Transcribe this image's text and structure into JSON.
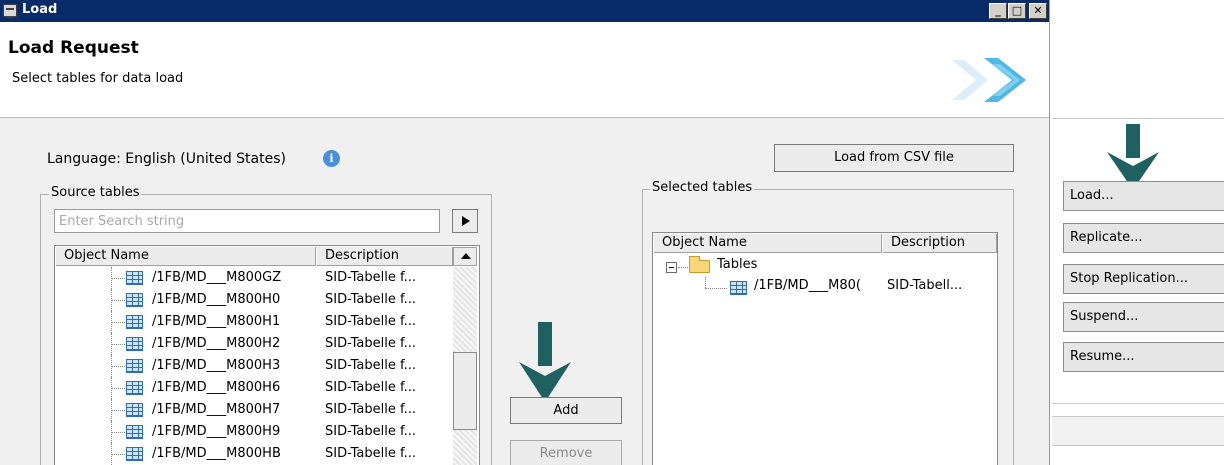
{
  "window": {
    "title": "Load",
    "controls": [
      "minimize",
      "maximize",
      "close"
    ]
  },
  "header": {
    "title": "Load Request",
    "subtitle": "Select tables for data load"
  },
  "language": {
    "label": "Language: English (United States)",
    "info_icon": "info-icon"
  },
  "buttons": {
    "load_csv": "Load from CSV file",
    "add": "Add",
    "remove": "Remove"
  },
  "source_tables": {
    "legend": "Source tables",
    "search_placeholder": "Enter Search string",
    "columns": [
      "Object Name",
      "Description"
    ],
    "rows": [
      {
        "name": "/1FB/MD___M800GZ",
        "description": "SID-Tabelle f..."
      },
      {
        "name": "/1FB/MD___M800H0",
        "description": "SID-Tabelle f..."
      },
      {
        "name": "/1FB/MD___M800H1",
        "description": "SID-Tabelle f..."
      },
      {
        "name": "/1FB/MD___M800H2",
        "description": "SID-Tabelle f..."
      },
      {
        "name": "/1FB/MD___M800H3",
        "description": "SID-Tabelle f..."
      },
      {
        "name": "/1FB/MD___M800H6",
        "description": "SID-Tabelle f..."
      },
      {
        "name": "/1FB/MD___M800H7",
        "description": "SID-Tabelle f..."
      },
      {
        "name": "/1FB/MD___M800H9",
        "description": "SID-Tabelle f..."
      },
      {
        "name": "/1FB/MD___M800HB",
        "description": "SID-Tabelle f..."
      }
    ]
  },
  "selected_tables": {
    "legend": "Selected tables",
    "columns": [
      "Object Name",
      "Description"
    ],
    "tree": {
      "folder": "Tables",
      "items": [
        {
          "name": "/1FB/MD___M80(",
          "description": "SID-Tabell..."
        }
      ]
    }
  },
  "command_panel": {
    "buttons": [
      "Load...",
      "Replicate...",
      "Stop Replication...",
      "Suspend...",
      "Resume..."
    ]
  },
  "colors": {
    "titlebar": "#0a2b6a",
    "annotation_arrow": "#1f6160",
    "dialog_bg": "#f0f0f0"
  }
}
